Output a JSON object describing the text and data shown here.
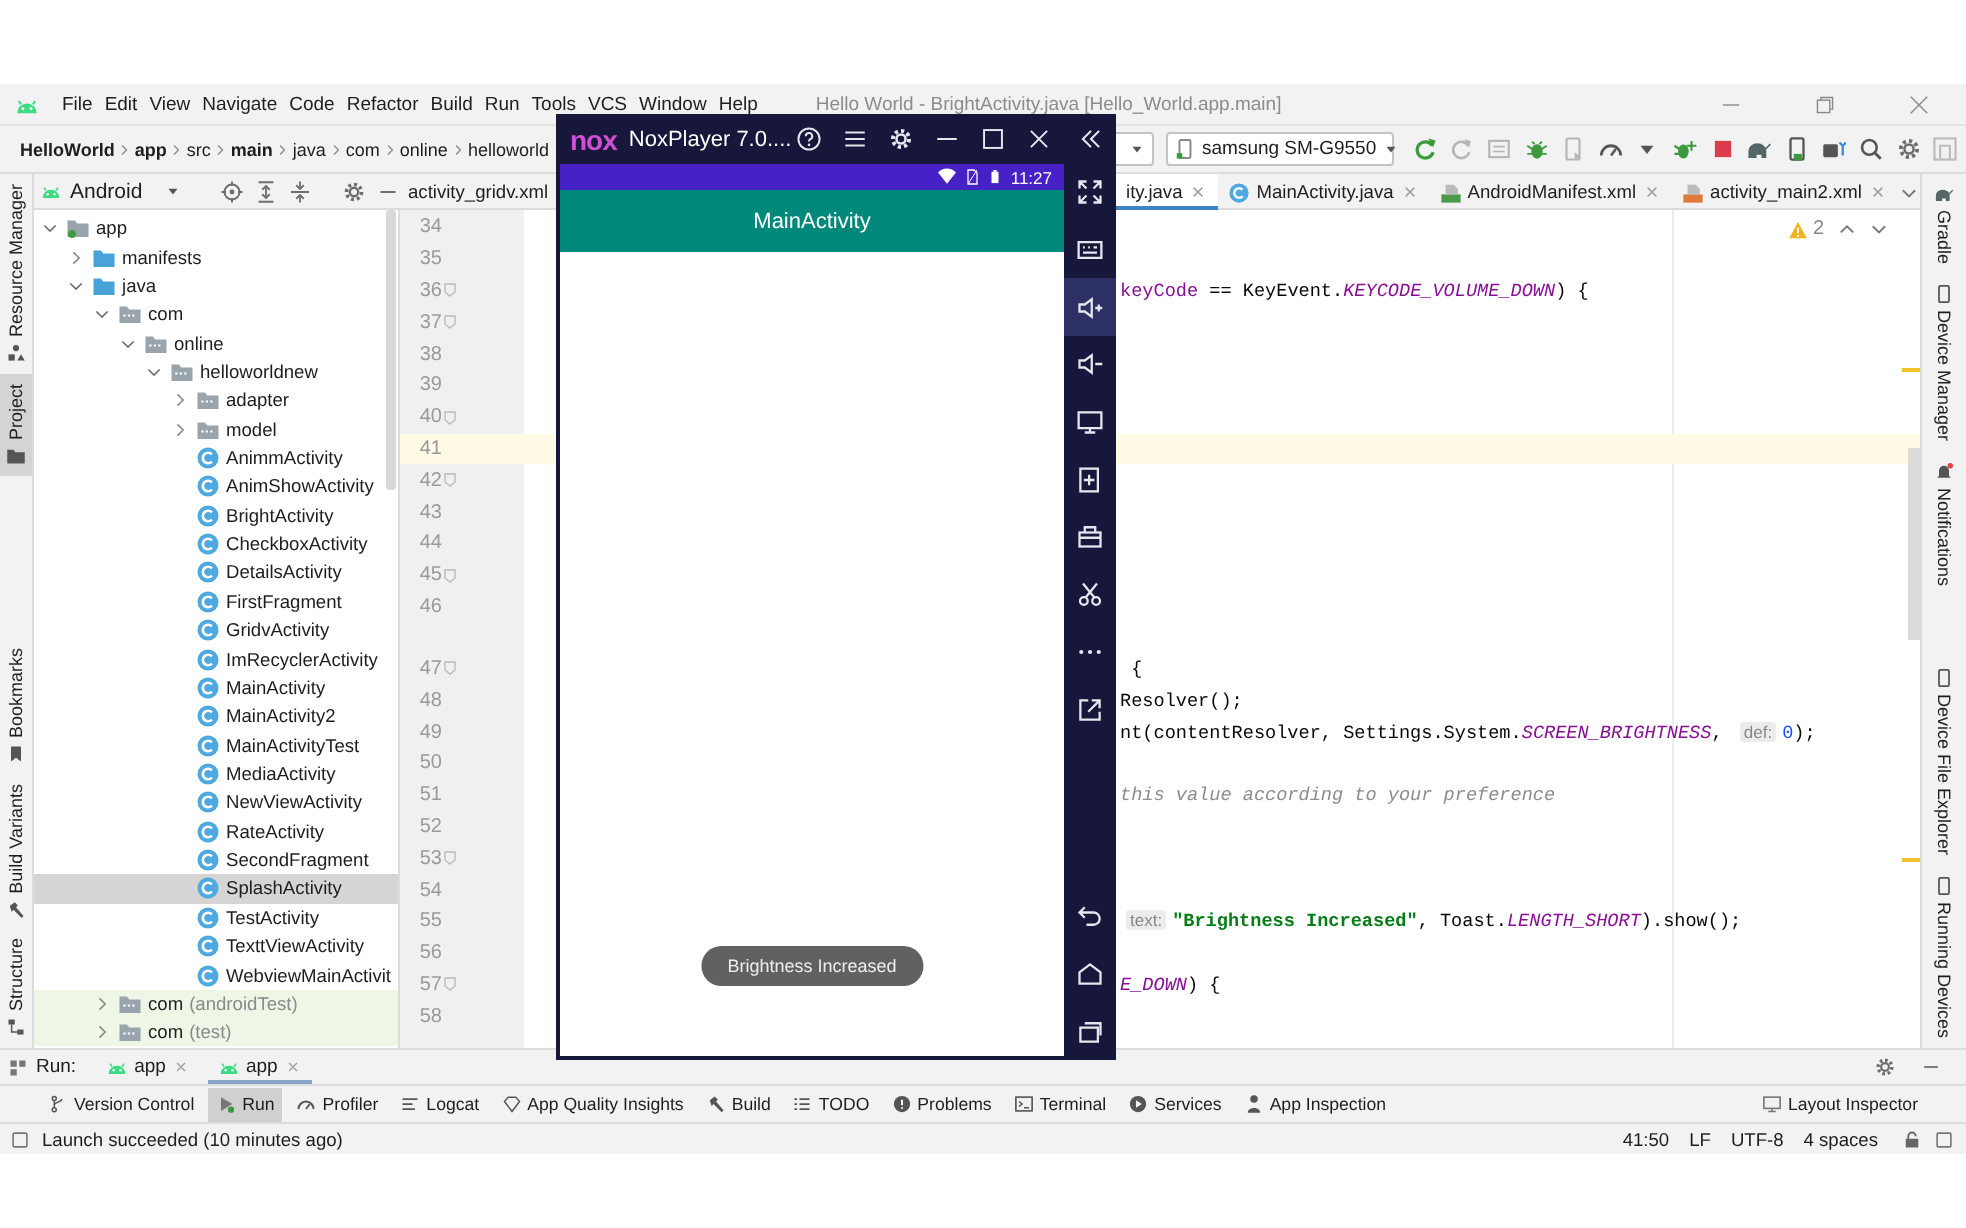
{
  "window": {
    "title": "Hello World - BrightActivity.java [Hello_World.app.main]",
    "menu": [
      "File",
      "Edit",
      "View",
      "Navigate",
      "Code",
      "Refactor",
      "Build",
      "Run",
      "Tools",
      "VCS",
      "Window",
      "Help"
    ]
  },
  "breadcrumb": [
    {
      "label": "HelloWorld",
      "bold": true
    },
    {
      "label": "app",
      "bold": true
    },
    {
      "label": "src",
      "bold": false
    },
    {
      "label": "main",
      "bold": true
    },
    {
      "label": "java",
      "bold": false
    },
    {
      "label": "com",
      "bold": false
    },
    {
      "label": "online",
      "bold": false
    },
    {
      "label": "helloworld",
      "bold": false
    }
  ],
  "toolbar": {
    "device": "samsung SM-G9550"
  },
  "left_stripe": {
    "top": [
      {
        "label": "Resource Manager",
        "selected": false
      },
      {
        "label": "Project",
        "selected": true
      }
    ],
    "bottom": [
      {
        "label": "Bookmarks",
        "selected": false
      },
      {
        "label": "Build Variants",
        "selected": false
      },
      {
        "label": "Structure",
        "selected": false
      }
    ]
  },
  "right_stripe": {
    "top": [
      "Gradle",
      "Device Manager",
      "Notifications"
    ],
    "bottom": [
      "Device File Explorer",
      "Running Devices"
    ]
  },
  "project": {
    "view": "Android",
    "tree": [
      {
        "label": "app",
        "kind": "module",
        "expanded": true,
        "selected": false,
        "children": [
          {
            "label": "manifests",
            "kind": "folder",
            "expanded": false,
            "selected": false
          },
          {
            "label": "java",
            "kind": "folder",
            "expanded": true,
            "selected": false,
            "children": [
              {
                "label": "com",
                "kind": "package",
                "expanded": true,
                "selected": false,
                "test": false,
                "children": [
                  {
                    "label": "online",
                    "kind": "package",
                    "expanded": true,
                    "selected": false,
                    "children": [
                      {
                        "label": "helloworldnew",
                        "kind": "package",
                        "expanded": true,
                        "selected": false,
                        "children": [
                          {
                            "label": "adapter",
                            "kind": "package",
                            "expanded": false,
                            "selected": false
                          },
                          {
                            "label": "model",
                            "kind": "package",
                            "expanded": false,
                            "selected": false
                          },
                          {
                            "label": "AnimmActivity",
                            "kind": "class",
                            "selected": false
                          },
                          {
                            "label": "AnimShowActivity",
                            "kind": "class",
                            "selected": false
                          },
                          {
                            "label": "BrightActivity",
                            "kind": "class",
                            "selected": false
                          },
                          {
                            "label": "CheckboxActivity",
                            "kind": "class",
                            "selected": false
                          },
                          {
                            "label": "DetailsActivity",
                            "kind": "class",
                            "selected": false
                          },
                          {
                            "label": "FirstFragment",
                            "kind": "class",
                            "selected": false
                          },
                          {
                            "label": "GridvActivity",
                            "kind": "class",
                            "selected": false
                          },
                          {
                            "label": "ImRecyclerActivity",
                            "kind": "class",
                            "selected": false
                          },
                          {
                            "label": "MainActivity",
                            "kind": "class",
                            "selected": false
                          },
                          {
                            "label": "MainActivity2",
                            "kind": "class",
                            "selected": false
                          },
                          {
                            "label": "MainActivityTest",
                            "kind": "class",
                            "selected": false
                          },
                          {
                            "label": "MediaActivity",
                            "kind": "class",
                            "selected": false
                          },
                          {
                            "label": "NewViewActivity",
                            "kind": "class",
                            "selected": false
                          },
                          {
                            "label": "RateActivity",
                            "kind": "class",
                            "selected": false
                          },
                          {
                            "label": "SecondFragment",
                            "kind": "class",
                            "selected": false
                          },
                          {
                            "label": "SplashActivity",
                            "kind": "class",
                            "selected": true
                          },
                          {
                            "label": "TestActivity",
                            "kind": "class",
                            "selected": false
                          },
                          {
                            "label": "TexttViewActivity",
                            "kind": "class",
                            "selected": false
                          },
                          {
                            "label": "WebviewMainActivit",
                            "kind": "class",
                            "selected": false
                          }
                        ]
                      }
                    ]
                  }
                ]
              },
              {
                "label": "com",
                "suffix": "(androidTest)",
                "kind": "package",
                "expanded": false,
                "selected": false,
                "test": true
              },
              {
                "label": "com",
                "suffix": "(test)",
                "kind": "package",
                "expanded": false,
                "selected": false,
                "test": true
              }
            ]
          }
        ]
      }
    ]
  },
  "editor": {
    "tabs": [
      {
        "label": "activity_gridv.xml",
        "selected": false
      },
      {
        "label": "ity.java",
        "selected": true
      },
      {
        "label": "MainActivity.java",
        "kind": "java",
        "selected": false
      },
      {
        "label": "AndroidManifest.xml",
        "kind": "manifest",
        "selected": false
      },
      {
        "label": "activity_main2.xml",
        "kind": "xml",
        "selected": false
      }
    ],
    "problems": "2",
    "lines": [
      {
        "kind": "line",
        "number": "34",
        "fold": false,
        "highlighted": false
      },
      {
        "kind": "line",
        "number": "35",
        "fold": false,
        "highlighted": false
      },
      {
        "kind": "line",
        "number": "36",
        "fold": true,
        "highlighted": false,
        "tokens": [
          {
            "kind": "field",
            "text": "keyCode"
          },
          {
            "kind": "plain",
            "text": " == KeyEvent."
          },
          {
            "kind": "constant",
            "text": "KEYCODE_VOLUME_DOWN"
          },
          {
            "kind": "plain",
            "text": ") {"
          }
        ]
      },
      {
        "kind": "line",
        "number": "37",
        "fold": true,
        "highlighted": false
      },
      {
        "kind": "line",
        "number": "38",
        "fold": false,
        "highlighted": false
      },
      {
        "kind": "line",
        "number": "39",
        "fold": false,
        "highlighted": false
      },
      {
        "kind": "line",
        "number": "40",
        "fold": true,
        "highlighted": false
      },
      {
        "kind": "line",
        "number": "41",
        "fold": false,
        "highlighted": true
      },
      {
        "kind": "line",
        "number": "42",
        "fold": true,
        "highlighted": false
      },
      {
        "kind": "line",
        "number": "43",
        "fold": false,
        "highlighted": false
      },
      {
        "kind": "line",
        "number": "44",
        "fold": false,
        "highlighted": false
      },
      {
        "kind": "line",
        "number": "45",
        "fold": true,
        "highlighted": false
      },
      {
        "kind": "line",
        "number": "46",
        "fold": false,
        "highlighted": false
      },
      {
        "kind": "inlay"
      },
      {
        "kind": "line",
        "number": "47",
        "fold": true,
        "highlighted": false,
        "tokens": [
          {
            "kind": "plain",
            "text": " {"
          }
        ]
      },
      {
        "kind": "line",
        "number": "48",
        "fold": false,
        "highlighted": false,
        "tokens": [
          {
            "kind": "plain",
            "text": "Resolver();"
          }
        ]
      },
      {
        "kind": "line",
        "number": "49",
        "fold": false,
        "highlighted": false,
        "tokens": [
          {
            "kind": "plain",
            "text": "nt(contentResolver, Settings.System."
          },
          {
            "kind": "constant",
            "text": "SCREEN_BRIGHTNESS"
          },
          {
            "kind": "plain",
            "text": ", "
          },
          {
            "kind": "hint",
            "text": "def:"
          },
          {
            "kind": "number",
            "text": "0"
          },
          {
            "kind": "plain",
            "text": ");"
          }
        ]
      },
      {
        "kind": "line",
        "number": "50",
        "fold": false,
        "highlighted": false
      },
      {
        "kind": "line",
        "number": "51",
        "fold": false,
        "highlighted": false,
        "tokens": [
          {
            "kind": "comment",
            "text": "this value according to your preference"
          }
        ]
      },
      {
        "kind": "line",
        "number": "52",
        "fold": false,
        "highlighted": false
      },
      {
        "kind": "line",
        "number": "53",
        "fold": true,
        "highlighted": false
      },
      {
        "kind": "line",
        "number": "54",
        "fold": false,
        "highlighted": false
      },
      {
        "kind": "line",
        "number": "55",
        "fold": false,
        "highlighted": false,
        "tokens": [
          {
            "kind": "hint",
            "text": "text:"
          },
          {
            "kind": "string",
            "text": "\"Brightness Increased\""
          },
          {
            "kind": "plain",
            "text": ", Toast."
          },
          {
            "kind": "constant",
            "text": "LENGTH_SHORT"
          },
          {
            "kind": "plain",
            "text": ").show();"
          }
        ]
      },
      {
        "kind": "line",
        "number": "56",
        "fold": false,
        "highlighted": false
      },
      {
        "kind": "line",
        "number": "57",
        "fold": true,
        "highlighted": false,
        "tokens": [
          {
            "kind": "constant",
            "text": "E_DOWN"
          },
          {
            "kind": "plain",
            "text": ") {"
          }
        ]
      },
      {
        "kind": "line",
        "number": "58",
        "fold": false,
        "highlighted": false
      }
    ]
  },
  "run_bar": {
    "label": "Run:",
    "tabs": [
      {
        "label": "app",
        "selected": false
      },
      {
        "label": "app",
        "selected": true
      }
    ]
  },
  "tool_windows": [
    {
      "label": "Version Control",
      "selected": false
    },
    {
      "label": "Run",
      "selected": true
    },
    {
      "label": "Profiler",
      "selected": false
    },
    {
      "label": "Logcat",
      "selected": false
    },
    {
      "label": "App Quality Insights",
      "selected": false
    },
    {
      "label": "Build",
      "selected": false
    },
    {
      "label": "TODO",
      "selected": false
    },
    {
      "label": "Problems",
      "selected": false
    },
    {
      "label": "Terminal",
      "selected": false
    },
    {
      "label": "Services",
      "selected": false
    },
    {
      "label": "App Inspection",
      "selected": false
    }
  ],
  "tool_windows_right": [
    "Layout Inspector"
  ],
  "status_bar": {
    "message": "Launch succeeded (10 minutes ago)",
    "items": [
      "41:50",
      "LF",
      "UTF-8",
      "4 spaces"
    ]
  },
  "emulator": {
    "logo": "nox",
    "title": "NoxPlayer 7.0....",
    "time": "11:27",
    "app_title": "MainActivity",
    "toast": "Brightness Increased",
    "side_tools": {
      "top": [
        {
          "selected": false
        },
        {
          "selected": false
        },
        {
          "selected": true
        },
        {
          "selected": false
        },
        {
          "selected": false
        },
        {
          "selected": false
        },
        {
          "selected": false
        },
        {
          "selected": false
        },
        {
          "selected": false
        },
        {
          "selected": false
        }
      ],
      "bottom": [
        {
          "selected": false
        },
        {
          "selected": false
        },
        {
          "selected": false
        }
      ]
    }
  }
}
